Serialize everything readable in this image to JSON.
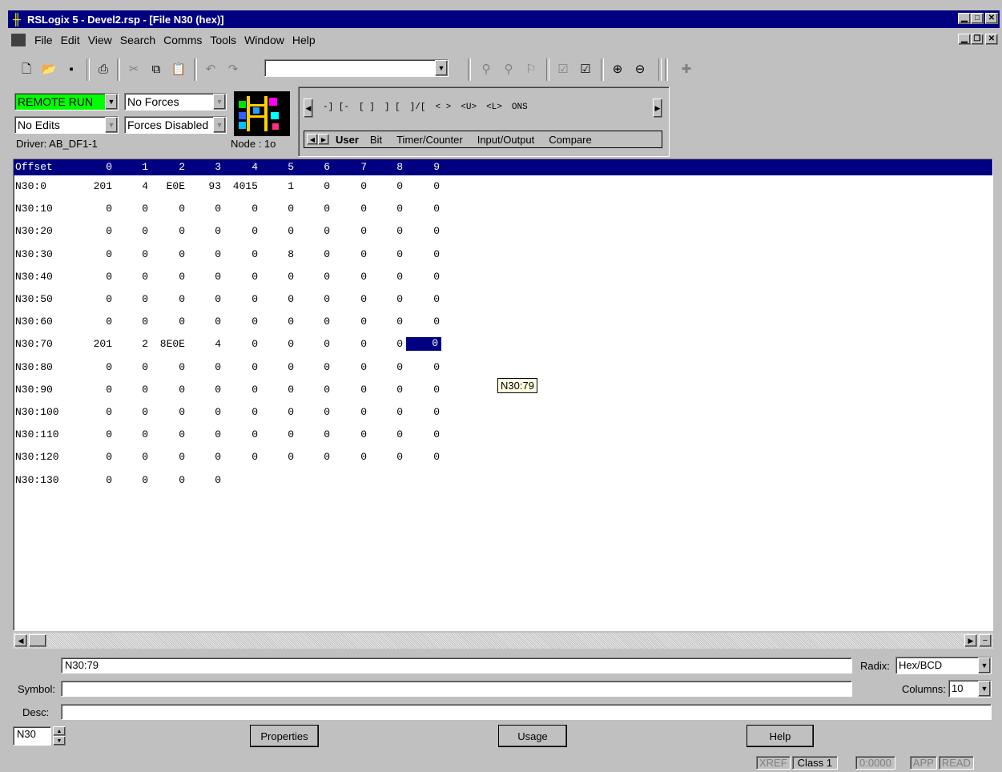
{
  "window": {
    "title": "RSLogix 5 - Devel2.rsp - [File N30 (hex)]",
    "controls": [
      "_",
      "□",
      "×"
    ],
    "doc_controls": [
      "_",
      "▫",
      "×"
    ]
  },
  "menu": [
    "File",
    "Edit",
    "View",
    "Search",
    "Comms",
    "Tools",
    "Window",
    "Help"
  ],
  "status": {
    "mode": "REMOTE RUN",
    "forces": "No Forces",
    "edits": "No Edits",
    "forces_enabled": "Forces Disabled",
    "driver": "Driver: AB_DF1-1",
    "node": "Node : 1o"
  },
  "instruction_bar": {
    "symbols": [
      "-] [-",
      "[  ]",
      "] [",
      "]/[",
      "< >",
      "<U>",
      "<L>",
      "ONS"
    ],
    "tabs": [
      "User",
      "Bit",
      "Timer/Counter",
      "Input/Output",
      "Compare"
    ],
    "active_tab": "User"
  },
  "table": {
    "headers": [
      "Offset",
      "0",
      "1",
      "2",
      "3",
      "4",
      "5",
      "6",
      "7",
      "8",
      "9"
    ],
    "rows": [
      {
        "offset": "N30:0",
        "values": [
          "201",
          "4",
          "E0E",
          "93",
          "4015",
          "1",
          "0",
          "0",
          "0",
          "0"
        ]
      },
      {
        "offset": "N30:10",
        "values": [
          "0",
          "0",
          "0",
          "0",
          "0",
          "0",
          "0",
          "0",
          "0",
          "0"
        ]
      },
      {
        "offset": "N30:20",
        "values": [
          "0",
          "0",
          "0",
          "0",
          "0",
          "0",
          "0",
          "0",
          "0",
          "0"
        ]
      },
      {
        "offset": "N30:30",
        "values": [
          "0",
          "0",
          "0",
          "0",
          "0",
          "8",
          "0",
          "0",
          "0",
          "0"
        ]
      },
      {
        "offset": "N30:40",
        "values": [
          "0",
          "0",
          "0",
          "0",
          "0",
          "0",
          "0",
          "0",
          "0",
          "0"
        ]
      },
      {
        "offset": "N30:50",
        "values": [
          "0",
          "0",
          "0",
          "0",
          "0",
          "0",
          "0",
          "0",
          "0",
          "0"
        ]
      },
      {
        "offset": "N30:60",
        "values": [
          "0",
          "0",
          "0",
          "0",
          "0",
          "0",
          "0",
          "0",
          "0",
          "0"
        ]
      },
      {
        "offset": "N30:70",
        "values": [
          "201",
          "2",
          "8E0E",
          "4",
          "0",
          "0",
          "0",
          "0",
          "0",
          "0"
        ]
      },
      {
        "offset": "N30:80",
        "values": [
          "0",
          "0",
          "0",
          "0",
          "0",
          "0",
          "0",
          "0",
          "0",
          "0"
        ]
      },
      {
        "offset": "N30:90",
        "values": [
          "0",
          "0",
          "0",
          "0",
          "0",
          "0",
          "0",
          "0",
          "0",
          "0"
        ]
      },
      {
        "offset": "N30:100",
        "values": [
          "0",
          "0",
          "0",
          "0",
          "0",
          "0",
          "0",
          "0",
          "0",
          "0"
        ]
      },
      {
        "offset": "N30:110",
        "values": [
          "0",
          "0",
          "0",
          "0",
          "0",
          "0",
          "0",
          "0",
          "0",
          "0"
        ]
      },
      {
        "offset": "N30:120",
        "values": [
          "0",
          "0",
          "0",
          "0",
          "0",
          "0",
          "0",
          "0",
          "0",
          "0"
        ]
      },
      {
        "offset": "N30:130",
        "values": [
          "0",
          "0",
          "0",
          "0"
        ]
      }
    ],
    "selected_address": "N30:79",
    "tooltip": "N30:79"
  },
  "bottom": {
    "address_value": "N30:79",
    "radix_label": "Radix:",
    "radix_value": "Hex/BCD",
    "symbol_label": "Symbol:",
    "symbol_value": "",
    "columns_label": "Columns:",
    "columns_value": "10",
    "desc_label": "Desc:",
    "desc_value": "",
    "file_value": "N30",
    "properties_label": "Properties",
    "usage_label": "Usage",
    "help_label": "Help"
  },
  "statusbar": [
    "XREF",
    "Class 1",
    "0:0000",
    "APP",
    "READ"
  ]
}
